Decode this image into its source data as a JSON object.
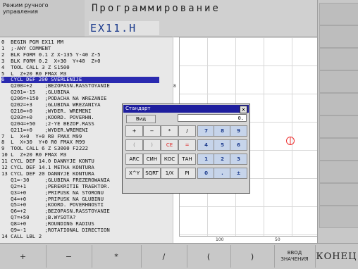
{
  "mode": {
    "label_line1": "Режим ручного",
    "label_line2": "управления"
  },
  "header": {
    "title": "Программирование",
    "file": "EX11.H"
  },
  "program": {
    "lines": [
      "0  BEGIN PGM EX11 MM",
      "1  ;-ANY COMMENT",
      "2  BLK FORM 0.1 Z X-135 Y-40 Z-5",
      "3  BLK FORM 0.2  X+30  Y+40  Z+0",
      "4  TOOL CALL 3 Z S1500",
      "5  L  Z+20 R0 FMAX M3",
      "6  CYCL DEF 200 SVERLENIJE",
      "   Q200=+2    ;BEZOPASN.RASSTOYANIE",
      "   Q201=-15   ;GLUBINA",
      "   Q206=+150  ;PODACHA NA WREZANIE",
      "   Q202=+3    ;GLUBINA WREZANIYA",
      "   Q210=+0    ;WYDER. WREMENI",
      "   Q203=+0    ;KOORD. POVERHN.",
      "   Q204=+50   ;2-YE BEZOP.RASS",
      "   Q211=+0    ;WYDER.WREMENI",
      "7  L  X+0  Y+0 R0 FMAX M99",
      "8  L  X+30  Y+0 R0 FMAX M99",
      "9  TOOL CALL 6 Z S3000 F2222",
      "10 L  Z+20 R0 FMAX M3",
      "11 CYCL DEF 14.0 DANNYJE KONTU",
      "12 CYCL DEF 14.1 METKA KONTURA",
      "13 CYCL DEF 20 DANNYJE KONTURA",
      "   Q1=-30     ;GLUBINA FREZEROWANIA",
      "   Q2=+1      ;PEREKRITIE TRAEKTOR.",
      "   Q3=+0      ;PRIPUSK NA STORONU",
      "   Q4=+0      ;PRIPUSK NA GLUBINU",
      "   Q5=+0      ;KOORD. POVERHNOSTI",
      "   Q6=+2      ;BEZOPASN.RASSTOYANIE",
      "   Q7=+50     ;B.WYSOTA?",
      "   Q8=+0      ;ROUNDING RADIUS",
      "   Q9=-1      ;ROTATIONAL DIRECTION",
      "14 CALL LBL 2"
    ],
    "selected_index": 6
  },
  "graphics": {
    "ruler_v_labels": [
      "8",
      "8"
    ],
    "ruler_h_labels": [
      "100",
      "50"
    ]
  },
  "calculator": {
    "title": "Стандарт",
    "close_glyph": "×",
    "view_label": "Вид",
    "display": "0.",
    "rows": [
      [
        "+",
        "−",
        "*",
        "/",
        "7",
        "8",
        "9"
      ],
      [
        "(",
        ")",
        "CE",
        "=",
        "4",
        "5",
        "6"
      ],
      [
        "ARC",
        "СИН",
        "КОС",
        "ТАН",
        "1",
        "2",
        "3"
      ],
      [
        "X^Y",
        "SQRT",
        "1/X",
        "PI",
        "0",
        ".",
        "±"
      ]
    ]
  },
  "softkeys": [
    "+",
    "−",
    "*",
    "/",
    "(",
    ")",
    "ВВОД\nЗНАЧЕНИЯ",
    "КОНЕЦ"
  ]
}
